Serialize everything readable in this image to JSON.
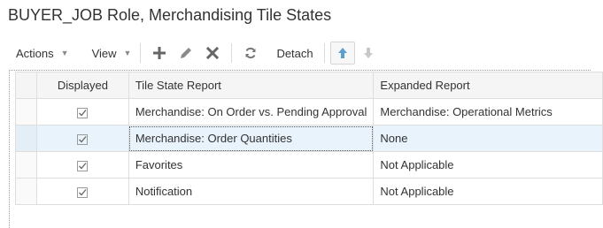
{
  "page": {
    "title": "BUYER_JOB Role, Merchandising Tile States"
  },
  "toolbar": {
    "actions_label": "Actions",
    "view_label": "View",
    "detach_label": "Detach",
    "icons": [
      "add-icon",
      "edit-icon",
      "delete-icon",
      "refresh-icon",
      "arrow-up-icon",
      "arrow-down-icon"
    ],
    "colors": {
      "icon_gray": "#666666",
      "icon_disabled": "#c8c8c8",
      "up_arrow_blue": "#5a9fd4"
    }
  },
  "table": {
    "columns": [
      "Displayed",
      "Tile State Report",
      "Expanded Report"
    ],
    "rows": [
      {
        "displayed": "checked",
        "tile_state_report": "Merchandise: On Order vs. Pending Approval",
        "expanded_report": "Merchandise: Operational Metrics"
      },
      {
        "displayed": "checked",
        "tile_state_report": "Merchandise: Order Quantities",
        "expanded_report": "None"
      },
      {
        "displayed": "checked",
        "tile_state_report": "Favorites",
        "expanded_report": "Not Applicable"
      },
      {
        "displayed": "checked",
        "tile_state_report": "Notification",
        "expanded_report": "Not Applicable"
      }
    ],
    "selected_row_index": 1,
    "colors": {
      "selected_row_bg": "#e9f3fb",
      "header_bg": "#f5f5f5",
      "border": "#dedede"
    }
  }
}
